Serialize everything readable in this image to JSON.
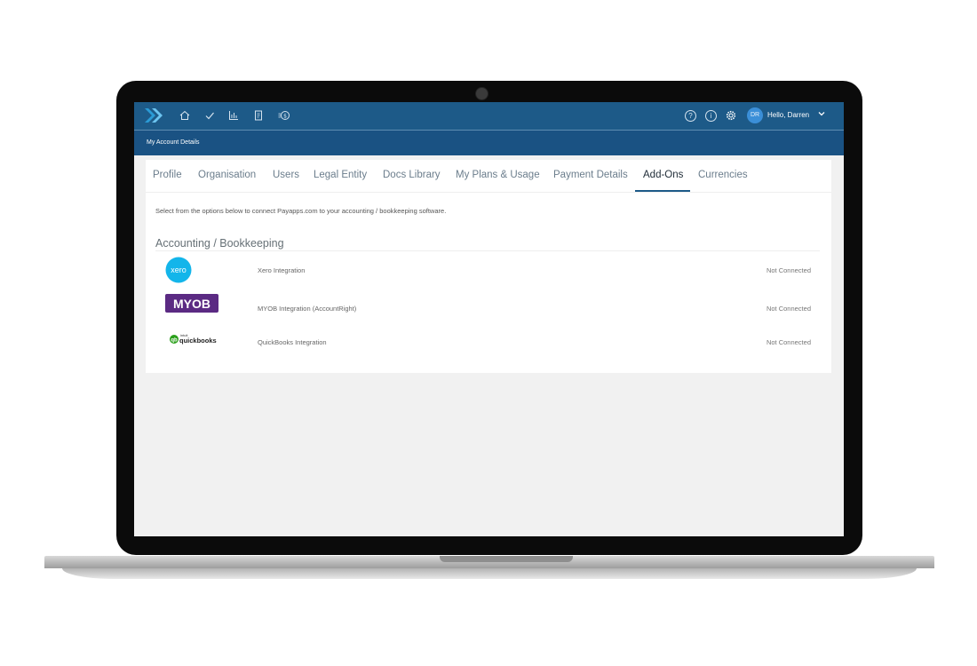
{
  "header": {
    "user_initials": "DR",
    "greeting": "Hello, Darren",
    "nav_icons": [
      "home-icon",
      "check-icon",
      "bar-chart-icon",
      "document-icon",
      "dollar-icon"
    ],
    "right_icons": [
      "help-icon",
      "info-icon",
      "gear-icon"
    ]
  },
  "subheader": {
    "title": "My Account Details"
  },
  "tabs": [
    {
      "label": "Profile"
    },
    {
      "label": "Organisation"
    },
    {
      "label": "Users"
    },
    {
      "label": "Legal Entity"
    },
    {
      "label": "Docs Library"
    },
    {
      "label": "My Plans & Usage"
    },
    {
      "label": "Payment Details"
    },
    {
      "label": "Add-Ons",
      "active": true
    },
    {
      "label": "Currencies"
    }
  ],
  "intro_text": "Select from the options below to connect Payapps.com to your accounting / bookkeeping software.",
  "section_title": "Accounting / Bookkeeping",
  "integrations": [
    {
      "logo": "xero",
      "logo_text": "xero",
      "name": "Xero Integration",
      "status": "Not Connected"
    },
    {
      "logo": "myob",
      "logo_text": "MYOB",
      "name": "MYOB Integration (AccountRight)",
      "status": "Not Connected"
    },
    {
      "logo": "quickbooks",
      "logo_text": "quickbooks",
      "logo_small_text": "intuit",
      "name": "QuickBooks Integration",
      "status": "Not Connected"
    }
  ],
  "colors": {
    "topbar": "#1d5a88",
    "subbar": "#1a5283",
    "accent": "#2b9bd6",
    "xero": "#13b5ea",
    "myob": "#5b2a83",
    "quickbooks": "#2ca01c"
  }
}
